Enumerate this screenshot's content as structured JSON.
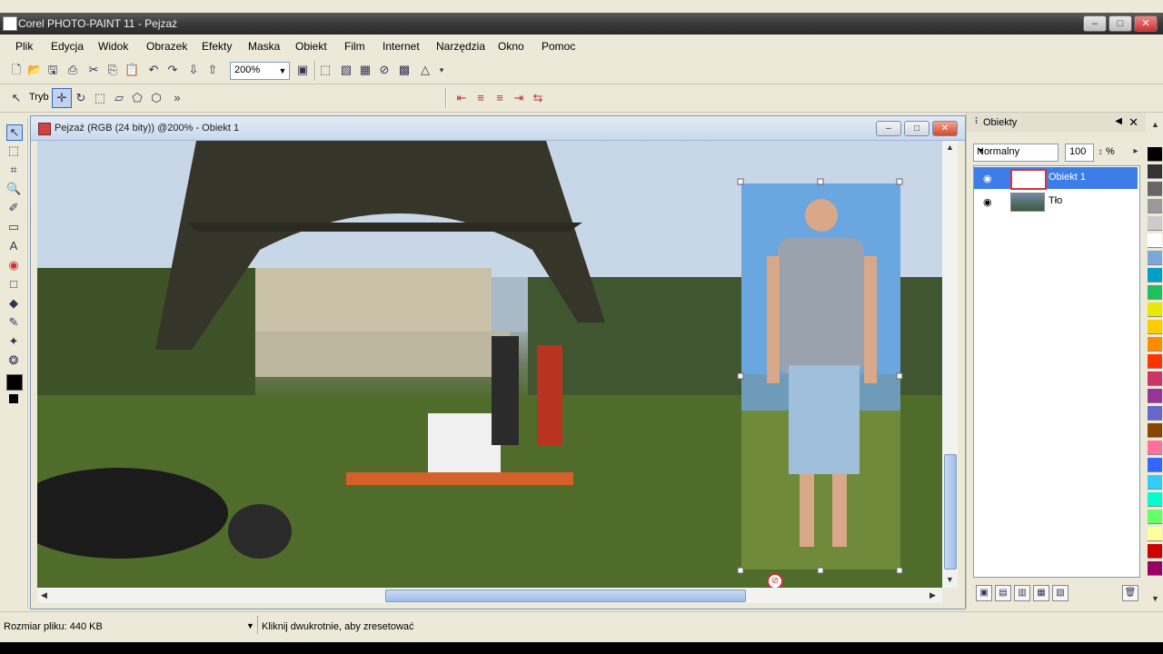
{
  "window": {
    "title": "Corel PHOTO-PAINT 11 - Pejzaż"
  },
  "menu": [
    "Plik",
    "Edycja",
    "Widok",
    "Obrazek",
    "Efekty",
    "Maska",
    "Obiekt",
    "Film",
    "Internet",
    "Narzędzia",
    "Okno",
    "Pomoc"
  ],
  "toolbar": {
    "zoom_value": "200%"
  },
  "property_bar": {
    "mode_label": "Tryb"
  },
  "document": {
    "title": "Pejzaż (RGB (24 bity)) @200% - Obiekt 1"
  },
  "objects_panel": {
    "title": "Obiekty",
    "blend_mode": "Normalny",
    "opacity": "100",
    "opacity_unit": "%",
    "layers": [
      {
        "name": "Obiekt 1",
        "selected": true
      },
      {
        "name": "Tło",
        "selected": false
      }
    ]
  },
  "status": {
    "file_size": "Rozmiar pliku: 440 KB",
    "hint": "Kliknij dwukrotnie, aby zresetować"
  },
  "palette_colors": [
    "#000000",
    "#333333",
    "#666666",
    "#999999",
    "#cccccc",
    "#ffffff",
    "#7da7d9",
    "#00a0c6",
    "#1fbf5f",
    "#e8e800",
    "#ffcc00",
    "#ff8c00",
    "#ff3300",
    "#cc3366",
    "#993399",
    "#6666cc",
    "#884400",
    "#ff6f9f",
    "#3366ff",
    "#33ccff",
    "#00ffcc",
    "#66ff66",
    "#ffff99",
    "#cc0000",
    "#990066"
  ]
}
